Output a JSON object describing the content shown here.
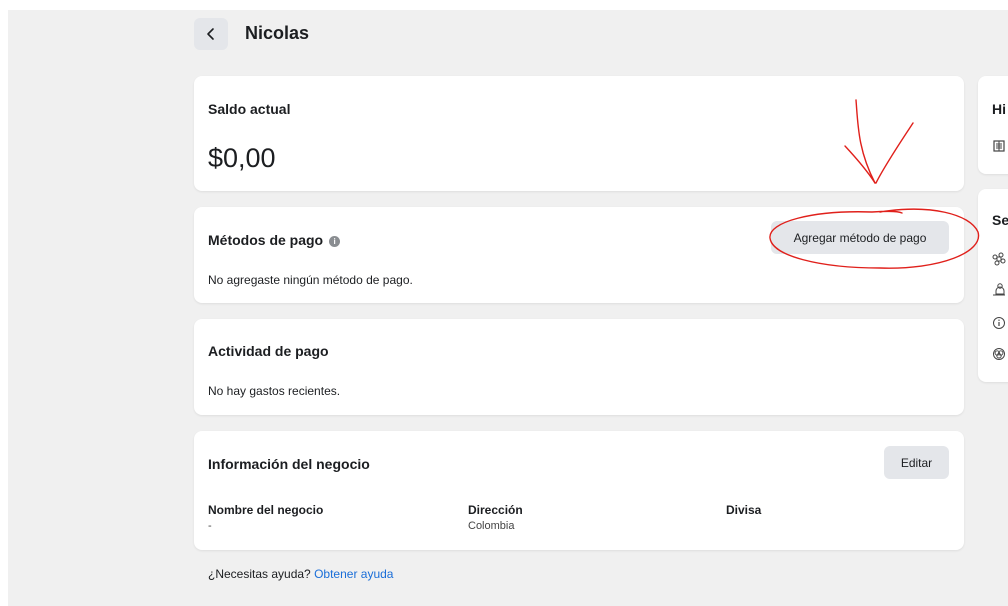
{
  "header": {
    "title": "Nicolas",
    "back_icon": "chevron-left-icon"
  },
  "balance": {
    "label": "Saldo actual",
    "amount": "$0,00"
  },
  "payment_methods": {
    "title": "Métodos de pago",
    "info_glyph": "i",
    "add_button": "Agregar método de pago",
    "empty_text": "No agregaste ningún método de pago."
  },
  "payment_activity": {
    "title": "Actividad de pago",
    "empty_text": "No hay gastos recientes."
  },
  "business_info": {
    "title": "Información del negocio",
    "edit_button": "Editar",
    "columns": [
      {
        "label": "Nombre del negocio",
        "value": "-"
      },
      {
        "label": "Dirección",
        "value": "Colombia"
      },
      {
        "label": "Divisa",
        "value": ""
      }
    ]
  },
  "side": {
    "history_title": "Hi",
    "settings_title": "Se"
  },
  "help": {
    "text": "¿Necesitas ayuda?",
    "link": "Obtener ayuda"
  },
  "colors": {
    "page_bg": "#f0f0f0",
    "card_bg": "#ffffff",
    "button_bg": "#e4e6ea",
    "link": "#1a6ed8",
    "annotation": "#e0201b"
  }
}
